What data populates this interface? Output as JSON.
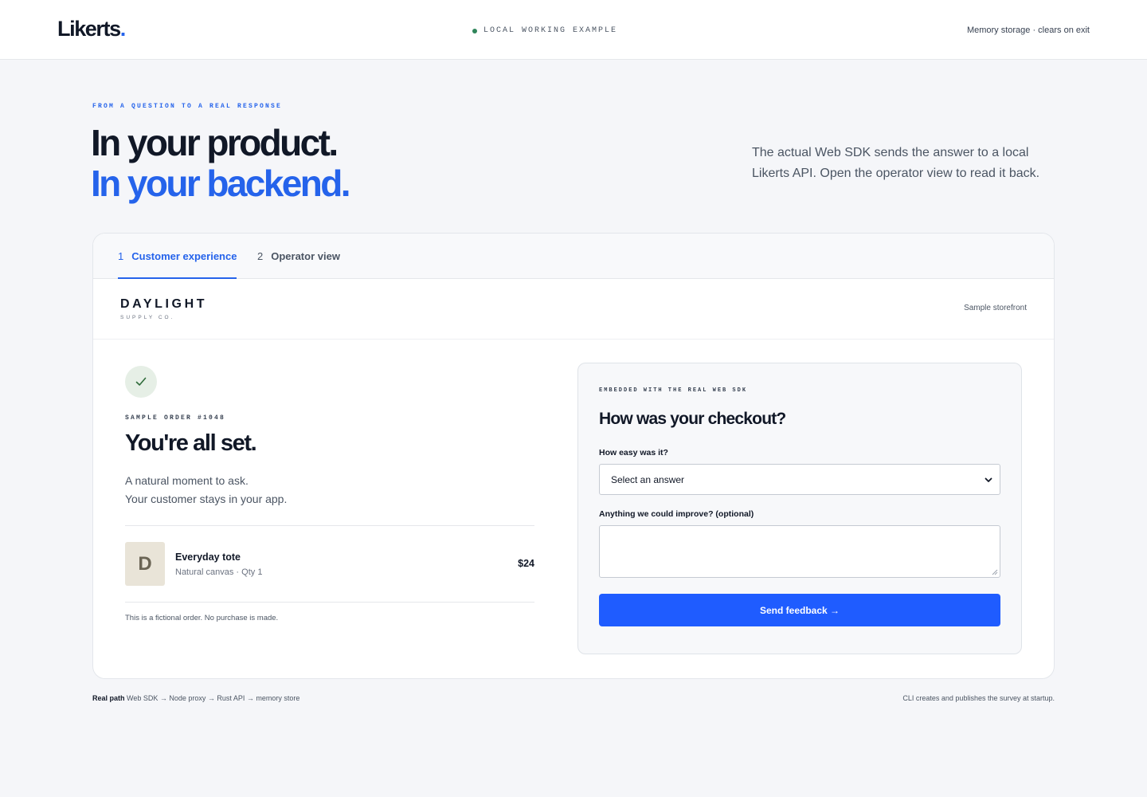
{
  "header": {
    "logo_text": "Likerts",
    "logo_dot": ".",
    "status_text": "LOCAL WORKING EXAMPLE",
    "status_color": "#2f855a",
    "storage_text": "Memory storage · clears on exit"
  },
  "hero": {
    "eyebrow": "FROM A QUESTION TO A REAL RESPONSE",
    "line1": "In your product.",
    "line2": "In your backend.",
    "description": "The actual Web SDK sends the answer to a local Likerts API. Open the operator view to read it back."
  },
  "tabs": [
    {
      "num": "1",
      "label": "Customer experience",
      "active": true
    },
    {
      "num": "2",
      "label": "Operator view",
      "active": false
    }
  ],
  "store": {
    "brand": "DAYLIGHT",
    "sub": "SUPPLY CO.",
    "tag": "Sample storefront"
  },
  "order": {
    "check_icon": "check-icon",
    "label": "SAMPLE ORDER #1048",
    "title": "You're all set.",
    "desc_line1": "A natural moment to ask.",
    "desc_line2": "Your customer stays in your app.",
    "item": {
      "thumb_letter": "D",
      "name": "Everyday tote",
      "meta": "Natural canvas · Qty 1",
      "price": "$24"
    },
    "fine_print": "This is a fictional order. No purchase is made."
  },
  "survey": {
    "eyebrow": "EMBEDDED WITH THE REAL WEB SDK",
    "title": "How was your checkout?",
    "q1_label": "How easy was it?",
    "q1_value": "Select an answer",
    "q2_label": "Anything we could improve? (optional)",
    "q2_value": "",
    "submit_label": "Send feedback →",
    "accent": "#1f5cff"
  },
  "footer": {
    "left_bold": "Real path",
    "left_text": "Web SDK → Node proxy → Rust API → memory store",
    "right_text": "CLI creates and publishes the survey at startup."
  }
}
